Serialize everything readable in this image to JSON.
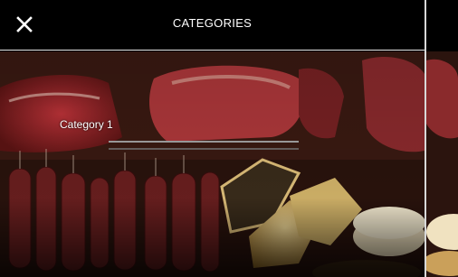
{
  "header": {
    "title": "CATEGORIES",
    "close_icon": "close-icon"
  },
  "categories": [
    {
      "label": "Category 1"
    }
  ],
  "colors": {
    "header_bg": "#000000",
    "text": "#ffffff",
    "divider": "#e8e8e8"
  }
}
